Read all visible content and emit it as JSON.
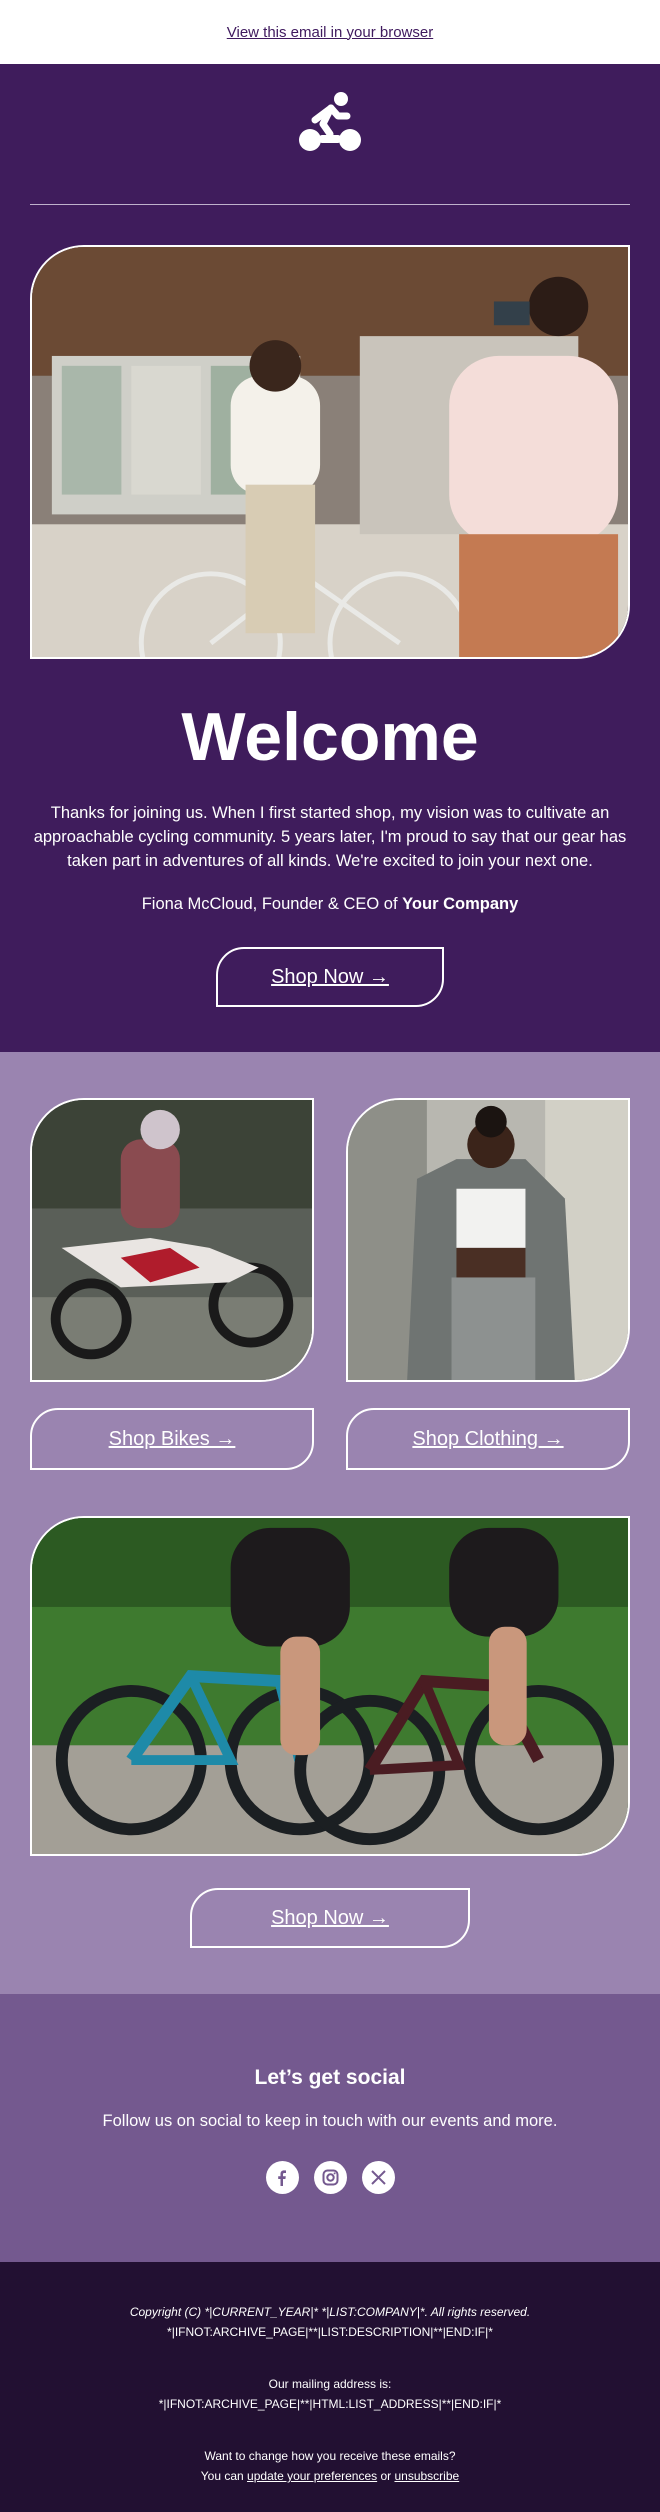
{
  "preheader": {
    "view_in_browser": "View this email in your browser"
  },
  "hero": {
    "logo_icon": "cyclist-icon",
    "title": "Welcome",
    "intro": "Thanks for joining us. When I first started shop, my vision was to cultivate an approachable cycling community. 5 years later, I'm proud to say that our gear has taken part in adventures of all kinds. We're excited to join your next one.",
    "signature_prefix": "Fiona McCloud, Founder & CEO of ",
    "signature_company": "Your Company",
    "cta": "Shop Now →"
  },
  "products": {
    "bikes_cta": "Shop Bikes →",
    "clothing_cta": "Shop Clothing →",
    "shop_cta": "Shop Now →"
  },
  "social": {
    "heading": "Let’s get social",
    "text": "Follow us on social to keep in touch with our events and more.",
    "icons": [
      "facebook-icon",
      "instagram-icon",
      "x-icon"
    ]
  },
  "footer": {
    "copyright": "Copyright (C) *|CURRENT_YEAR|* *|LIST:COMPANY|*. All rights reserved.",
    "description_merge": "*|IFNOT:ARCHIVE_PAGE|**|LIST:DESCRIPTION|**|END:IF|*",
    "mailing_label": "Our mailing address is:",
    "address_merge": "*|IFNOT:ARCHIVE_PAGE|**|HTML:LIST_ADDRESS|**|END:IF|*",
    "change_prompt": "Want to change how you receive these emails?",
    "you_can": "You can ",
    "update_link": "update your preferences",
    "or": " or ",
    "unsubscribe_link": "unsubscribe"
  },
  "colors": {
    "hero_bg": "#3f1c5c",
    "products_bg": "#9a84b0",
    "social_bg": "#74598f",
    "footer_bg": "#221032"
  }
}
